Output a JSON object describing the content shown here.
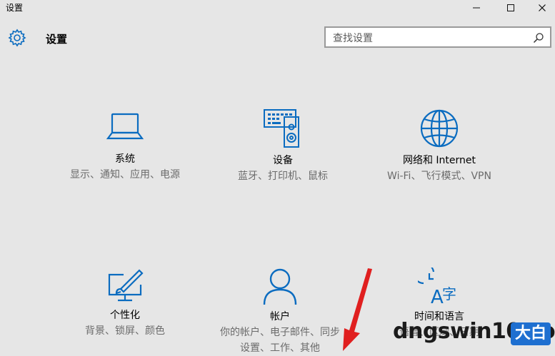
{
  "window": {
    "title": "设置",
    "minimize_glyph": "—",
    "maximize_glyph": "☐",
    "close_glyph": "✕"
  },
  "header": {
    "title": "设置",
    "icon": "gear-icon"
  },
  "search": {
    "placeholder": "查找设置",
    "icon": "search-icon"
  },
  "tiles": [
    {
      "id": "system",
      "title": "系统",
      "subtitle": "显示、通知、应用、电源",
      "icon": "laptop-icon"
    },
    {
      "id": "devices",
      "title": "设备",
      "subtitle": "蓝牙、打印机、鼠标",
      "icon": "devices-icon"
    },
    {
      "id": "network",
      "title": "网络和 Internet",
      "subtitle": "Wi-Fi、飞行模式、VPN",
      "icon": "globe-icon"
    },
    {
      "id": "personalization",
      "title": "个性化",
      "subtitle": "背景、锁屏、颜色",
      "icon": "paint-icon"
    },
    {
      "id": "accounts",
      "title": "帐户",
      "subtitle": "你的帐户、电子邮件、同步设置、工作、其他",
      "icon": "person-icon"
    },
    {
      "id": "time-language",
      "title": "时间和语言",
      "subtitle": "语音、区域、日期",
      "icon": "time-language-icon"
    }
  ],
  "watermark": {
    "text": "dngswin10.com",
    "badge": "大白"
  },
  "colors": {
    "accent": "#0b6cc0",
    "background": "#e6e6e6",
    "subtitle": "#6b6b6b",
    "arrow": "#e01f1f"
  }
}
